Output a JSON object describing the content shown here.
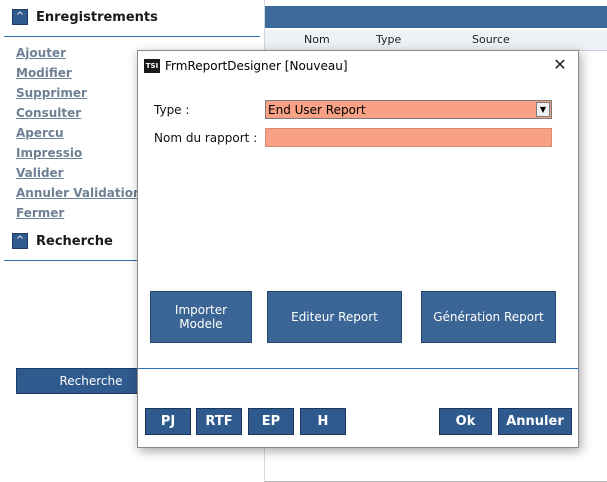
{
  "left_panel": {
    "section1_title": "Enregistrements",
    "section2_title": "Recherche",
    "collapse_glyph": "^",
    "menu": [
      "Ajouter",
      "Modifier",
      "Supprimer",
      "Consulter",
      "Apercu",
      "Impressio",
      "Valider",
      "Annuler Validation",
      "Fermer"
    ],
    "search_button": "Recherche"
  },
  "grid": {
    "columns": [
      "Nom",
      "Type",
      "Source"
    ]
  },
  "dialog": {
    "logo_text": "TSI",
    "title": "FrmReportDesigner [Nouveau]",
    "close_glyph": "✕",
    "type_label": "Type :",
    "type_value": "End User Report",
    "nom_label": "Nom du rapport :",
    "nom_value": "",
    "buttons": {
      "importer": "Importer Modele",
      "editeur": "Editeur Report",
      "generation": "Génération Report"
    },
    "bottom_buttons": {
      "pj": "PJ",
      "rtf": "RTF",
      "ep": "EP",
      "h": "H",
      "ok": "Ok",
      "annuler": "Annuler"
    }
  },
  "colors": {
    "accent": "#2f5a8e",
    "field_bg": "#f9a184",
    "header_bar": "#3c6a9b"
  },
  "icons": {
    "collapse": "chevron-up-icon",
    "dropdown": "chevron-down-icon",
    "close": "close-icon"
  }
}
